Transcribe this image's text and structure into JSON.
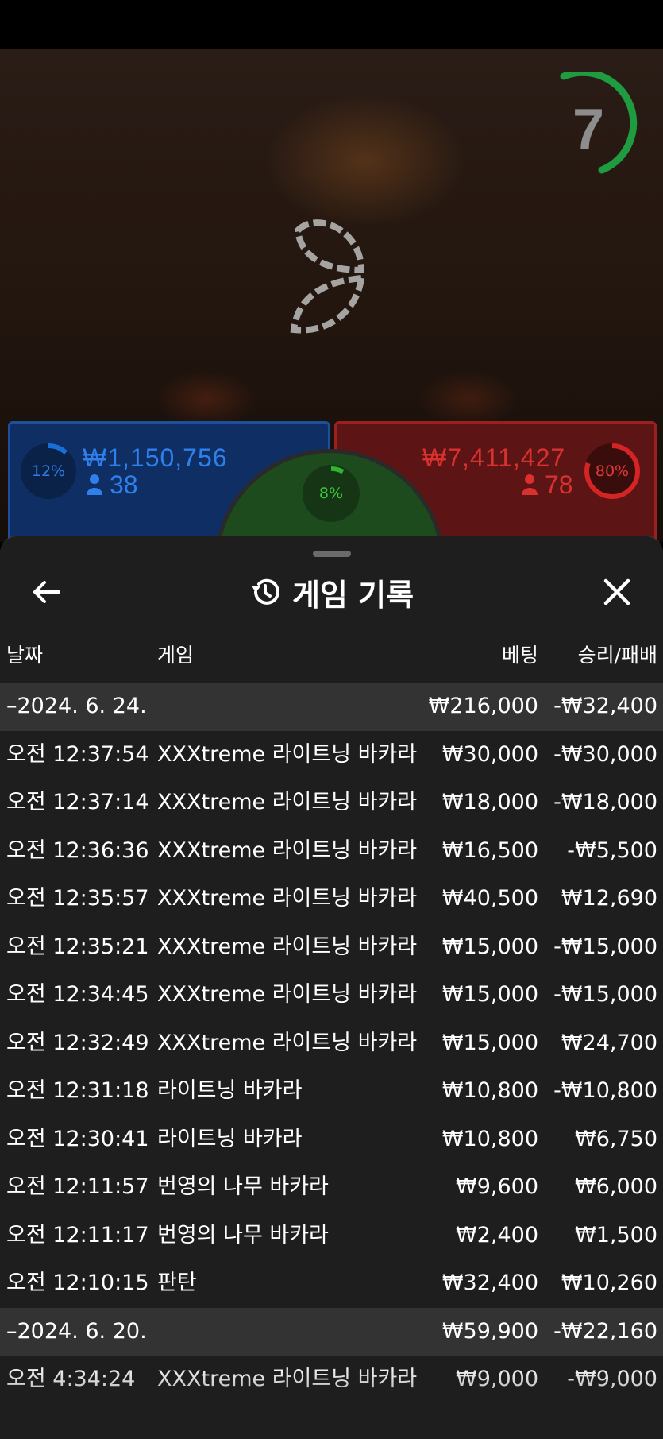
{
  "countdown": "7",
  "bets": {
    "player": {
      "percent": "12%",
      "amount": "₩1,150,756",
      "players": "38",
      "fill": 0.12,
      "color": "#1a6fd6"
    },
    "banker": {
      "percent": "80%",
      "amount": "₩7,411,427",
      "players": "78",
      "fill": 0.8,
      "color": "#d42424"
    },
    "tie": {
      "percent": "8%",
      "fill": 0.08,
      "color": "#2fb52f"
    }
  },
  "sheet": {
    "title": "게임 기록",
    "columns": {
      "date": "날짜",
      "game": "게임",
      "bet": "베팅",
      "result": "승리/패배"
    },
    "rows": [
      {
        "type": "group",
        "date": "–2024. 6. 24.",
        "game": "",
        "bet": "₩216,000",
        "result": "-₩32,400"
      },
      {
        "type": "item",
        "date": "오전 12:37:54",
        "game": "XXXtreme 라이트닝 바카라",
        "bet": "₩30,000",
        "result": "-₩30,000"
      },
      {
        "type": "item",
        "date": "오전 12:37:14",
        "game": "XXXtreme 라이트닝 바카라",
        "bet": "₩18,000",
        "result": "-₩18,000"
      },
      {
        "type": "item",
        "date": "오전 12:36:36",
        "game": "XXXtreme 라이트닝 바카라",
        "bet": "₩16,500",
        "result": "-₩5,500"
      },
      {
        "type": "item",
        "date": "오전 12:35:57",
        "game": "XXXtreme 라이트닝 바카라",
        "bet": "₩40,500",
        "result": "₩12,690"
      },
      {
        "type": "item",
        "date": "오전 12:35:21",
        "game": "XXXtreme 라이트닝 바카라",
        "bet": "₩15,000",
        "result": "-₩15,000"
      },
      {
        "type": "item",
        "date": "오전 12:34:45",
        "game": "XXXtreme 라이트닝 바카라",
        "bet": "₩15,000",
        "result": "-₩15,000"
      },
      {
        "type": "item",
        "date": "오전 12:32:49",
        "game": "XXXtreme 라이트닝 바카라",
        "bet": "₩15,000",
        "result": "₩24,700"
      },
      {
        "type": "item",
        "date": "오전 12:31:18",
        "game": "라이트닝 바카라",
        "bet": "₩10,800",
        "result": "-₩10,800"
      },
      {
        "type": "item",
        "date": "오전 12:30:41",
        "game": "라이트닝 바카라",
        "bet": "₩10,800",
        "result": "₩6,750"
      },
      {
        "type": "item",
        "date": "오전 12:11:57",
        "game": "번영의 나무 바카라",
        "bet": "₩9,600",
        "result": "₩6,000"
      },
      {
        "type": "item",
        "date": "오전 12:11:17",
        "game": "번영의 나무 바카라",
        "bet": "₩2,400",
        "result": "₩1,500"
      },
      {
        "type": "item",
        "date": "오전 12:10:15",
        "game": "판탄",
        "bet": "₩32,400",
        "result": "₩10,260"
      },
      {
        "type": "group",
        "date": "–2024. 6. 20.",
        "game": "",
        "bet": "₩59,900",
        "result": "-₩22,160"
      },
      {
        "type": "item",
        "date": "오전 4:34:24",
        "game": "XXXtreme 라이트닝 바카라",
        "bet": "₩9,000",
        "result": "-₩9,000"
      }
    ]
  }
}
